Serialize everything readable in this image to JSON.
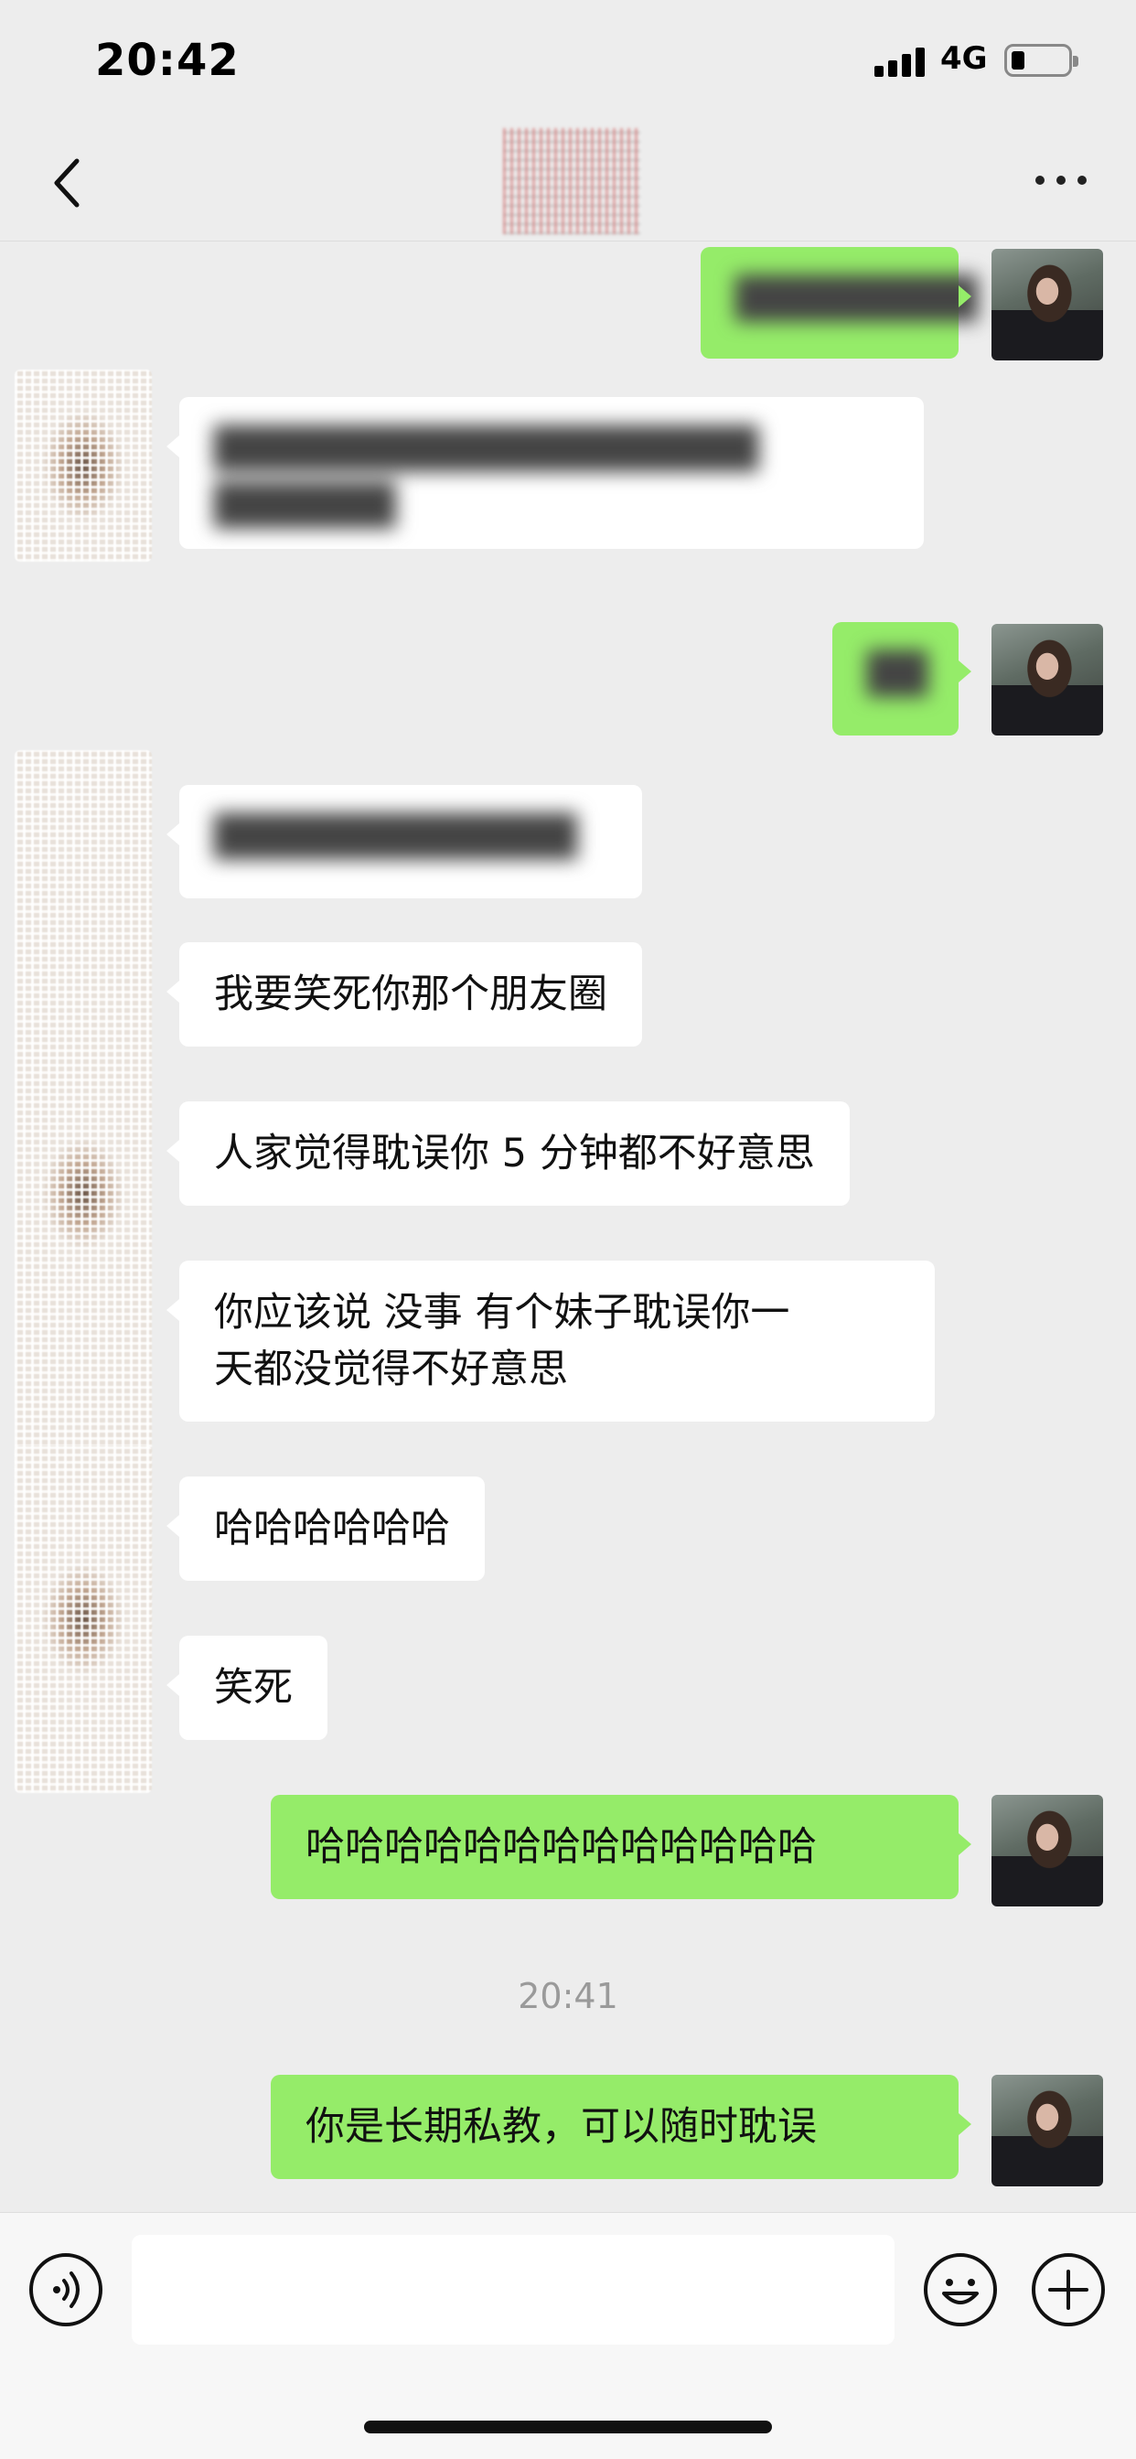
{
  "status_bar": {
    "time": "20:42",
    "network": "4G",
    "battery_level": 0.15
  },
  "nav": {
    "back_icon": "chevron-left-icon",
    "more_icon": "ellipsis-icon"
  },
  "messages": [
    {
      "side": "out",
      "text": "",
      "blurred": true
    },
    {
      "side": "in",
      "text": "",
      "blurred": true
    },
    {
      "side": "out",
      "text": "",
      "blurred": true
    },
    {
      "side": "in",
      "text": "",
      "blurred": true
    },
    {
      "side": "in",
      "text": "我要笑死你那个朋友圈"
    },
    {
      "side": "in",
      "text": "人家觉得耽误你 5 分钟都不好意思"
    },
    {
      "side": "in",
      "line1": "你应该说 没事 有个妹子耽误你一",
      "line2": "天都没觉得不好意思"
    },
    {
      "side": "in",
      "text": "哈哈哈哈哈哈"
    },
    {
      "side": "in",
      "text": "笑死"
    },
    {
      "side": "out",
      "text": "哈哈哈哈哈哈哈哈哈哈哈哈哈"
    },
    {
      "side": "out",
      "text": "你是长期私教，可以随时耽误"
    }
  ],
  "timestamp": "20:41",
  "input_bar": {
    "voice_icon": "voice-icon",
    "emoji_icon": "emoji-icon",
    "plus_icon": "plus-icon",
    "placeholder": ""
  }
}
